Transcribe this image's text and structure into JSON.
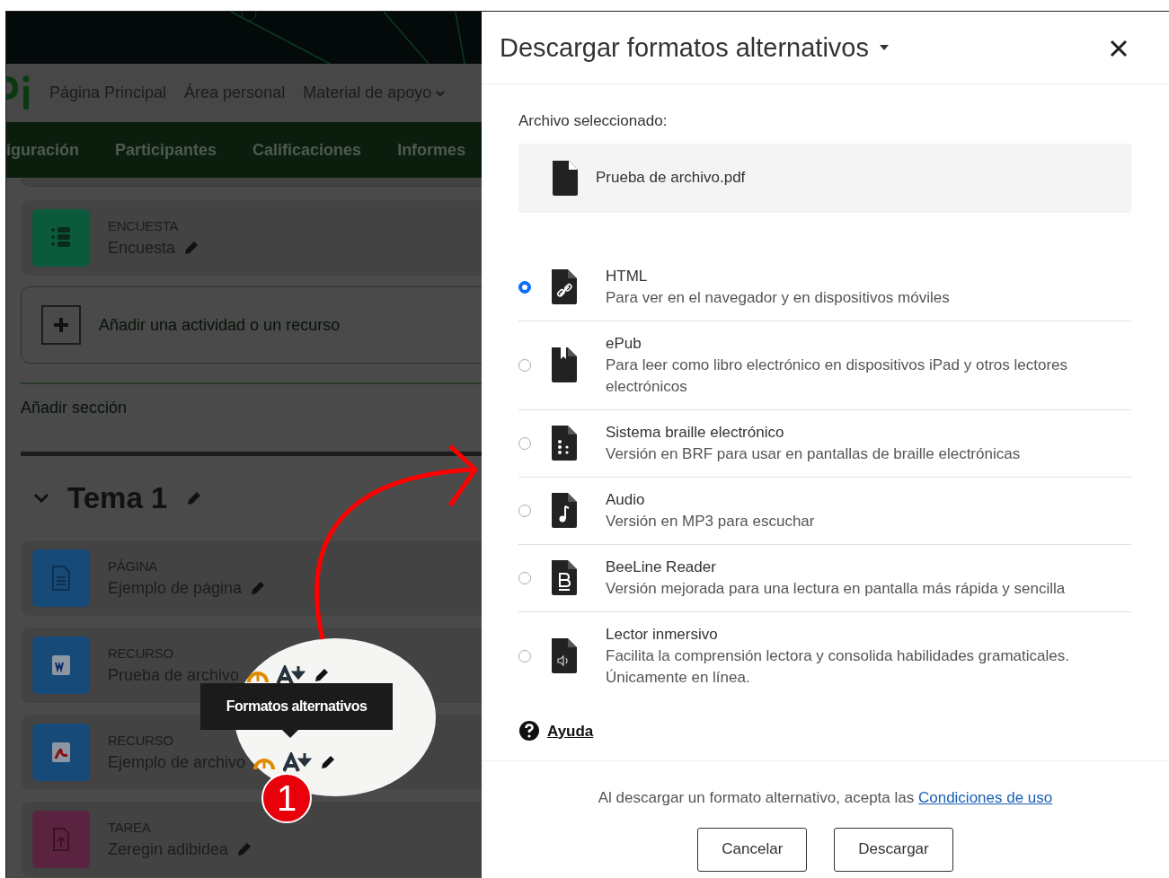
{
  "navbar": {
    "links": [
      {
        "label": "Página Principal",
        "dropdown": false
      },
      {
        "label": "Área personal",
        "dropdown": false
      },
      {
        "label": "Material de apoyo",
        "dropdown": true
      }
    ]
  },
  "course_nav": [
    "iguración",
    "Participantes",
    "Calificaciones",
    "Informes"
  ],
  "activities_top": [
    {
      "kind": "survey",
      "type": "ENCUESTA",
      "name": "Encuesta",
      "color": "#0b5a3c",
      "tools": false
    }
  ],
  "add_activity": "Añadir una actividad o un recurso",
  "add_section": "Añadir sección",
  "section": {
    "title": "Tema 1",
    "expanded": true,
    "activities": [
      {
        "kind": "page",
        "type": "PÁGINA",
        "name": "Ejemplo de página",
        "color": "#164a78",
        "tools": false
      },
      {
        "kind": "word",
        "type": "RECURSO",
        "name": "Prueba de archivo",
        "color": "#164a78",
        "tools": true
      },
      {
        "kind": "pdf",
        "type": "RECURSO",
        "name": "Ejemplo de archivo",
        "color": "#164a78",
        "tools": true
      },
      {
        "kind": "assignment",
        "type": "TAREA",
        "name": "Zeregin adibidea",
        "color": "#5a2340",
        "tools": false
      }
    ]
  },
  "annotation": {
    "tooltip": "Formatos alternativos",
    "badge": "1"
  },
  "modal": {
    "title": "Descargar formatos alternativos",
    "selected_label": "Archivo seleccionado:",
    "file_name": "Prueba de archivo.pdf",
    "options": [
      {
        "kind": "html",
        "title": "HTML",
        "description": "Para ver en el navegador y en dispositivos móviles",
        "selected": true
      },
      {
        "kind": "epub",
        "title": "ePub",
        "description": "Para leer como libro electrónico en dispositivos iPad y otros lectores electrónicos",
        "selected": false
      },
      {
        "kind": "braille",
        "title": "Sistema braille electrónico",
        "description": "Versión en BRF para usar en pantallas de braille electrónicas",
        "selected": false
      },
      {
        "kind": "audio",
        "title": "Audio",
        "description": "Versión en MP3 para escuchar",
        "selected": false
      },
      {
        "kind": "beeline",
        "title": "BeeLine Reader",
        "description": "Versión mejorada para una lectura en pantalla más rápida y sencilla",
        "selected": false
      },
      {
        "kind": "immersive",
        "title": "Lector inmersivo",
        "description": "Facilita la comprensión lectora y consolida habilidades gramaticales. Únicamente en línea.",
        "selected": false
      }
    ],
    "help": "Ayuda",
    "footer_text": "Al descargar un formato alternativo, acepta las",
    "footer_link": "Condiciones de uso",
    "buttons": [
      "Cancelar",
      "Descargar"
    ]
  }
}
